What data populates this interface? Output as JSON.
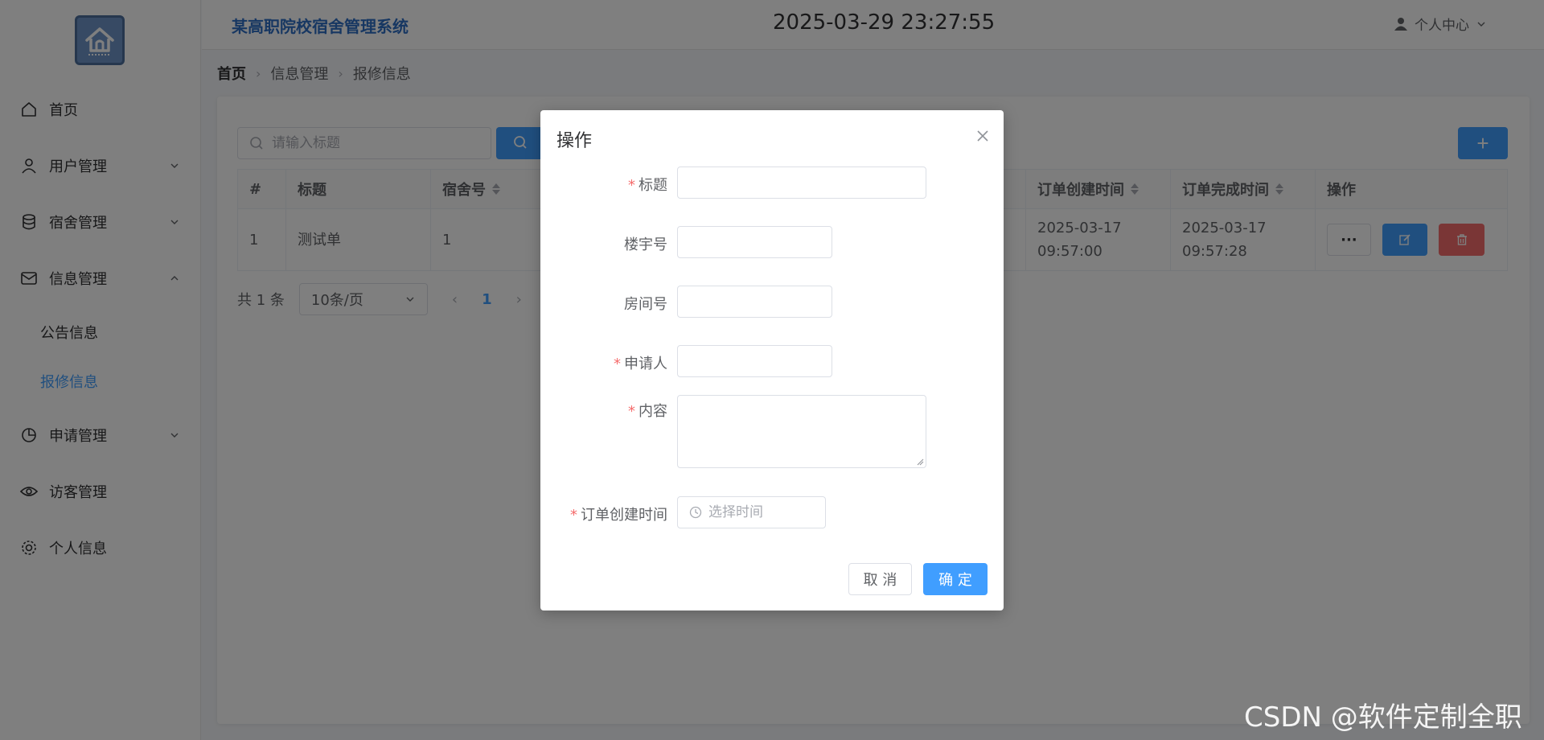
{
  "header": {
    "system_title": "某高职院校宿舍管理系统",
    "clock": "2025-03-29 23:27:55",
    "user_center": "个人中心"
  },
  "sidebar": {
    "logo_icon": "house-icon",
    "items": [
      {
        "label": "首页",
        "icon": "home-icon"
      },
      {
        "label": "用户管理",
        "icon": "user-icon"
      },
      {
        "label": "宿舍管理",
        "icon": "database-icon"
      },
      {
        "label": "信息管理",
        "icon": "message-icon",
        "expanded": true
      },
      {
        "label": "申请管理",
        "icon": "pie-chart-icon"
      },
      {
        "label": "访客管理",
        "icon": "eye-icon"
      },
      {
        "label": "个人信息",
        "icon": "gear-icon"
      }
    ],
    "sub_items": [
      {
        "label": "公告信息"
      },
      {
        "label": "报修信息",
        "active": true
      }
    ]
  },
  "breadcrumb": [
    "首页",
    "信息管理",
    "报修信息"
  ],
  "toolbar": {
    "search_placeholder": "请输入标题",
    "add_label": "+"
  },
  "table": {
    "columns": [
      "#",
      "标题",
      "宿舍号",
      "订单创建时间",
      "订单完成时间",
      "操作"
    ],
    "rows": [
      {
        "index": "1",
        "title": "测试单",
        "room": "1",
        "created": "2025-03-17 09:57:00",
        "finished": "2025-03-17 09:57:28"
      }
    ],
    "more_label": "···"
  },
  "pagination": {
    "total": "共 1 条",
    "page_size": "10条/页",
    "current_page": "1"
  },
  "dialog": {
    "title": "操作",
    "required_mark": "*",
    "fields": {
      "title_label": "标题",
      "building_label": "楼宇号",
      "room_label": "房间号",
      "applicant_label": "申请人",
      "content_label": "内容",
      "created_time_label": "订单创建时间",
      "created_time_placeholder": "选择时间"
    },
    "cancel_label": "取 消",
    "ok_label": "确 定"
  },
  "watermark": "CSDN @软件定制全职",
  "colors": {
    "primary": "#409eff",
    "danger": "#f56c6c",
    "title_blue": "#2f6fc5"
  }
}
